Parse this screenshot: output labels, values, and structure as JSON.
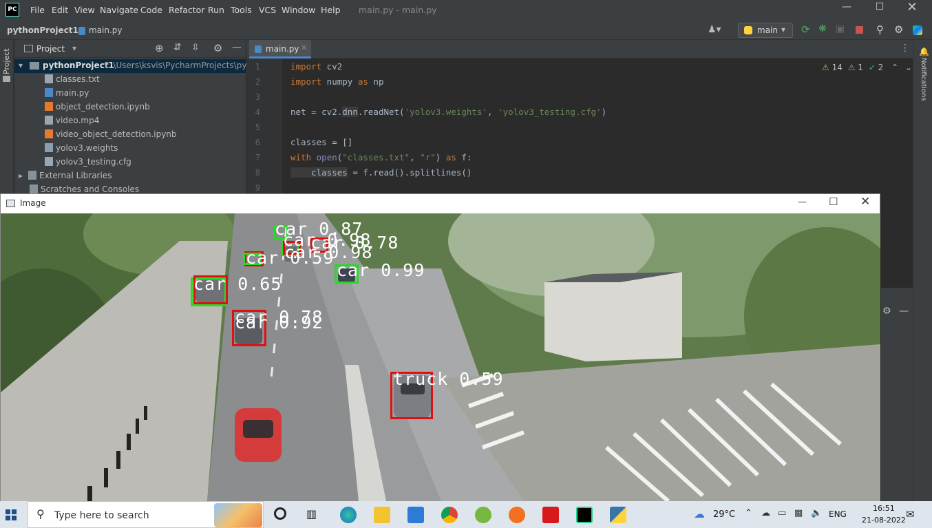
{
  "menubar": {
    "logo": "PC",
    "items": [
      "File",
      "Edit",
      "View",
      "Navigate",
      "Code",
      "Refactor",
      "Run",
      "Tools",
      "VCS",
      "Window",
      "Help"
    ],
    "title": "main.py - main.py"
  },
  "navbar": {
    "project": "pythonProject1",
    "file": "main.py",
    "branch": "main"
  },
  "project_panel": {
    "title": "Project",
    "root_name": "pythonProject1",
    "root_path": "C:\\Users\\ksvis\\PycharmProjects\\pytho",
    "files": [
      "classes.txt",
      "main.py",
      "object_detection.ipynb",
      "video.mp4",
      "video_object_detection.ipynb",
      "yolov3.weights",
      "yolov3_testing.cfg"
    ],
    "external": "External Libraries",
    "scratches": "Scratches and Consoles"
  },
  "side_labels": {
    "left": "Project",
    "right": "Notifications"
  },
  "editor": {
    "tab": "main.py",
    "inspections": {
      "warnings": "14",
      "weak": "1",
      "ok": "2"
    },
    "line_numbers": [
      "1",
      "2",
      "3",
      "4",
      "5",
      "6",
      "7",
      "8",
      "9"
    ],
    "lines": {
      "l1": [
        "import",
        " cv2"
      ],
      "l2": [
        "import",
        " numpy ",
        "as",
        " np"
      ],
      "l4": [
        "net = cv2.",
        "dnn",
        ".readNet(",
        "'yolov3.weights'",
        ", ",
        "'yolov3_testing.cfg'",
        ")"
      ],
      "l6": "classes = []",
      "l7": [
        "with ",
        "open",
        "(",
        "\"classes.txt\"",
        ", ",
        "\"r\"",
        ") ",
        "as",
        " f:"
      ],
      "l8": [
        "    classes",
        " = f.read().splitlines()"
      ]
    }
  },
  "image_window": {
    "title": "Image",
    "detections": [
      {
        "text": "car 0.87"
      },
      {
        "text": "car 0.98"
      },
      {
        "text": "car 0.78"
      },
      {
        "text": "car 0.98"
      },
      {
        "text": "car 0.59"
      },
      {
        "text": "car 0.99"
      },
      {
        "text": "car 0.65"
      },
      {
        "text": "car 0.78"
      },
      {
        "text": "car 0.92"
      },
      {
        "text": "truck 0.59"
      }
    ]
  },
  "taskbar": {
    "search_placeholder": "Type here to search",
    "weather": "29°C",
    "lang": "ENG",
    "time": "16:51",
    "date": "21-08-2022"
  },
  "colors": {
    "box_green": "#22dd22",
    "box_red": "#dd1111",
    "ide_bg": "#2b2b2b",
    "accent": "#4a88c7"
  }
}
